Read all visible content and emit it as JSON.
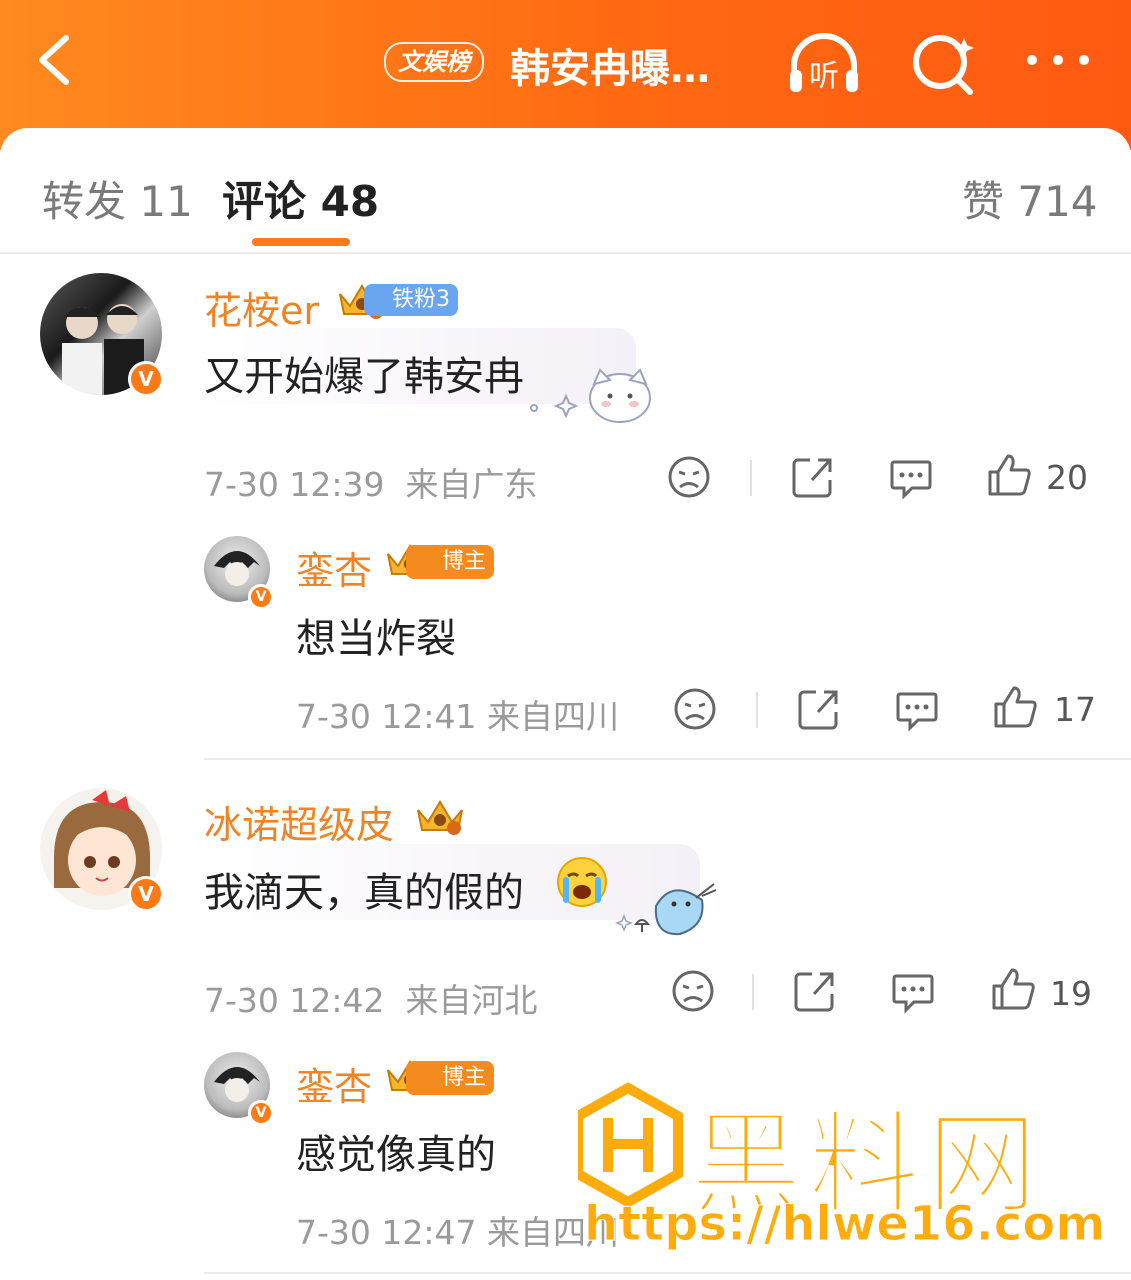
{
  "header": {
    "tag": "文娱榜",
    "title": "韩安冉曝…",
    "listen_label": "听"
  },
  "tabs": {
    "repost": "转发 11",
    "comment": "评论 48",
    "like": "赞 714"
  },
  "comments": [
    {
      "user": "花桉er",
      "fan_badge": "铁粉3",
      "text": "又开始爆了韩安冉",
      "time": "7-30 12:39",
      "location": "来自广东",
      "likes": "20",
      "reply": {
        "user": "銮杏",
        "badge": "博主",
        "text": "想当炸裂",
        "time": "7-30 12:41",
        "location": "来自四川",
        "likes": "17"
      }
    },
    {
      "user": "冰诺超级皮",
      "text": "我滴天，真的假的",
      "time": "7-30 12:42",
      "location": "来自河北",
      "likes": "19",
      "reply": {
        "user": "銮杏",
        "badge": "博主",
        "text": "感觉像真的",
        "time": "7-30 12:47",
        "location": "来自四川"
      }
    }
  ],
  "watermark": {
    "text": "黑料网",
    "url": "https://hlwe16.com"
  },
  "colors": {
    "accent": "#ff7a1a",
    "username": "#f08324",
    "header": "#ff6a12"
  }
}
